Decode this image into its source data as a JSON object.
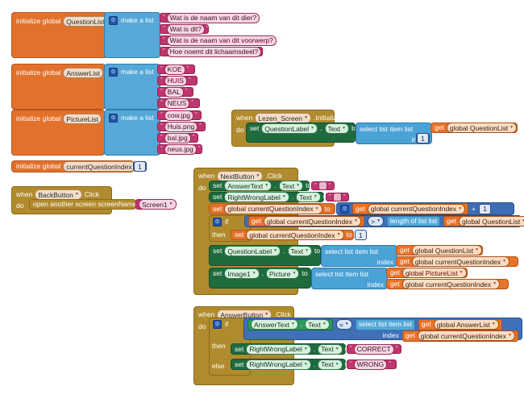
{
  "app": {
    "editor": "MIT App Inventor Blocks Editor",
    "screen": "Lezen_Screen"
  },
  "words": {
    "initialize_global": "initialize global",
    "to": "to",
    "make_a_list": "make a list",
    "when": "when",
    "do": "do",
    "set": "set",
    "get": "get",
    "if": "if",
    "then": "then",
    "else": "else",
    "index": "index",
    "dot": ".",
    "select_list_item": "select list item  list",
    "length_of_list": "length of list  list",
    "open_another_screen": "open another screen   screenName",
    "quote": "”",
    "plus": "+"
  },
  "globals": [
    {
      "name": "QuestionList",
      "kind": "list",
      "items": [
        "Wat is de naam van dit dier?",
        "Wat is dit?",
        "Wat is de naam van dit voorwerp?",
        "Hoe noemt dit lichaamsdeel?"
      ]
    },
    {
      "name": "AnswerList",
      "kind": "list",
      "items": [
        "KOE",
        "HUIS",
        "BAL",
        "NEUS"
      ]
    },
    {
      "name": "PictureList",
      "kind": "list",
      "items": [
        "cow.jpg",
        "Huis.png",
        "bal.jpg",
        "neus.jpg"
      ]
    },
    {
      "name": "currentQuestionIndex",
      "kind": "number",
      "value": "1"
    }
  ],
  "screen_init": {
    "event_component": "Lezen_Screen",
    "event_name": ".Initialize",
    "set_component": "QuestionLabel",
    "set_property": "Text",
    "list_global": "global QuestionList",
    "index_value": "1"
  },
  "back_button": {
    "event_component": "BackButton",
    "event_name": "Click",
    "action": "open another screen   screenName",
    "screen_name": "Screen1"
  },
  "next_button": {
    "event_component": "NextButton",
    "event_name": ".Click",
    "stmt1": {
      "component": "AnswerText",
      "property": "Text",
      "value": ""
    },
    "stmt2": {
      "component": "RightWrongLabel",
      "property": "Text",
      "value": ""
    },
    "stmt3": {
      "target": "global currentQuestionIndex",
      "operand_a": "global currentQuestionIndex",
      "operator": "+",
      "operand_b": "1"
    },
    "condition": {
      "left": "global currentQuestionIndex",
      "operator": ">",
      "right_fn": "length of list  list",
      "right_arg": "global QuestionList"
    },
    "then_stmt": {
      "target": "global currentQuestionIndex",
      "value": "1"
    },
    "stmt4": {
      "component": "QuestionLabel",
      "property": "Text",
      "list_global": "global QuestionList",
      "index_global": "global currentQuestionIndex"
    },
    "stmt5": {
      "component": "Image1",
      "property": "Picture",
      "list_global": "global PictureList",
      "index_global": "global currentQuestionIndex"
    }
  },
  "answer_button": {
    "event_component": "AnswerButton",
    "event_name": ".Click",
    "condition": {
      "left_component": "AnswerText",
      "left_property": "Text",
      "operator": "=",
      "right_fn": "select list item  list",
      "right_list": "global AnswerList",
      "right_index": "global currentQuestionIndex"
    },
    "then_stmt": {
      "component": "RightWrongLabel",
      "property": "Text",
      "value": "CORRECT"
    },
    "else_stmt": {
      "component": "RightWrongLabel",
      "property": "Text",
      "value": "WRONG"
    }
  },
  "colors": {
    "variable": "#e2712c",
    "getter": "#e8732a",
    "list": "#55a8d8",
    "text": "#c0356f",
    "event": "#b08b2e",
    "setter": "#1f6b3e",
    "math": "#3d6db5",
    "logic": "#3f70b8",
    "canvas": "#ffffff"
  }
}
